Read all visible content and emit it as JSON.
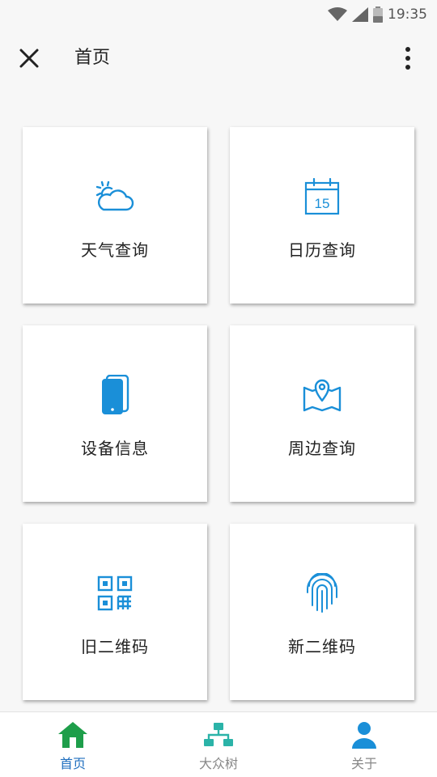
{
  "status_bar": {
    "time": "19:35"
  },
  "app_bar": {
    "title": "首页"
  },
  "grid": {
    "items": [
      {
        "label": "天气查询",
        "icon": "weather-icon"
      },
      {
        "label": "日历查询",
        "icon": "calendar-icon",
        "day": "15"
      },
      {
        "label": "设备信息",
        "icon": "device-icon"
      },
      {
        "label": "周边查询",
        "icon": "map-pin-icon"
      },
      {
        "label": "旧二维码",
        "icon": "qr-code-icon"
      },
      {
        "label": "新二维码",
        "icon": "fingerprint-icon"
      }
    ]
  },
  "bottom_nav": {
    "items": [
      {
        "label": "首页",
        "icon": "home-icon",
        "active": true
      },
      {
        "label": "大众树",
        "icon": "tree-icon",
        "active": false
      },
      {
        "label": "关于",
        "icon": "person-icon",
        "active": false
      }
    ]
  },
  "colors": {
    "accent": "#1a8fd8",
    "home_green": "#1e9e4a",
    "tree_teal": "#2bb3a8"
  }
}
